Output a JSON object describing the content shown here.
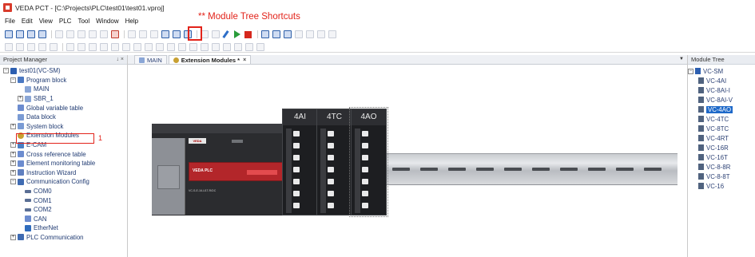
{
  "window": {
    "title": "VEDA PCT - [C:\\Projects\\PLC\\test01\\test01.vproj]"
  },
  "menu": {
    "items": [
      "File",
      "Edit",
      "View",
      "PLC",
      "Tool",
      "Window",
      "Help"
    ]
  },
  "annotation": {
    "shortcut_label": "** Module Tree Shortcuts",
    "step_number": "1"
  },
  "project_manager": {
    "title": "Project Manager",
    "pin_label": "↓ ×",
    "tree": [
      {
        "label": "test01(VC-SM)",
        "icon": "project-icon",
        "depth": 0,
        "expander": "−"
      },
      {
        "label": "Program block",
        "icon": "program-block-icon",
        "depth": 1,
        "expander": "−"
      },
      {
        "label": "MAIN",
        "icon": "ladder-icon",
        "depth": 2,
        "expander": ""
      },
      {
        "label": "SBR_1",
        "icon": "ladder-icon",
        "depth": 2,
        "expander": "+"
      },
      {
        "label": "Global variable table",
        "icon": "table-icon",
        "depth": 1,
        "expander": ""
      },
      {
        "label": "Data block",
        "icon": "block-icon",
        "depth": 1,
        "expander": ""
      },
      {
        "label": "System block",
        "icon": "block-icon",
        "depth": 1,
        "expander": "+"
      },
      {
        "label": "Extension Modules",
        "icon": "gear-icon",
        "depth": 1,
        "expander": "",
        "highlighted": true
      },
      {
        "label": "E-CAM",
        "icon": "ecam-icon",
        "depth": 1,
        "expander": "+"
      },
      {
        "label": "Cross reference table",
        "icon": "table-icon",
        "depth": 1,
        "expander": "+"
      },
      {
        "label": "Element monitoring table",
        "icon": "table-icon",
        "depth": 1,
        "expander": "+"
      },
      {
        "label": "Instruction Wizard",
        "icon": "wizard-icon",
        "depth": 1,
        "expander": "+"
      },
      {
        "label": "Communication Config",
        "icon": "comm-icon",
        "depth": 1,
        "expander": "−"
      },
      {
        "label": "COM0",
        "icon": "port-icon",
        "depth": 2,
        "expander": ""
      },
      {
        "label": "COM1",
        "icon": "port-icon",
        "depth": 2,
        "expander": ""
      },
      {
        "label": "COM2",
        "icon": "port-icon",
        "depth": 2,
        "expander": ""
      },
      {
        "label": "CAN",
        "icon": "can-icon",
        "depth": 2,
        "expander": ""
      },
      {
        "label": "EtherNet",
        "icon": "ethernet-icon",
        "depth": 2,
        "expander": ""
      },
      {
        "label": "PLC Communication",
        "icon": "comm-icon",
        "depth": 1,
        "expander": "+"
      }
    ]
  },
  "tabs": [
    {
      "label": "MAIN",
      "icon": "ladder-icon",
      "active": false,
      "close": ""
    },
    {
      "label": "Extension Modules *",
      "icon": "gear-icon",
      "active": true,
      "close": "×"
    }
  ],
  "canvas": {
    "plc_brand": "VEDA PLC",
    "plc_logo": "VEDA",
    "plc_model": "VC-S-E-16-U1T-R/DC",
    "modules": [
      "4AI",
      "4TC",
      "4AO"
    ]
  },
  "module_tree": {
    "title": "Module Tree",
    "root": "VC-SM",
    "items": [
      "VC-4AI",
      "VC-8AI-I",
      "VC-8AI-V",
      "VC-4AO",
      "VC-4TC",
      "VC-8TC",
      "VC-4RT",
      "VC-16R",
      "VC-16T",
      "VC-8-8R",
      "VC-8-8T",
      "VC-16"
    ],
    "selected": "VC-4AO"
  },
  "colors": {
    "annotation": "#e2231a",
    "selection": "#1e69c9",
    "plc_red": "#b3262a"
  }
}
